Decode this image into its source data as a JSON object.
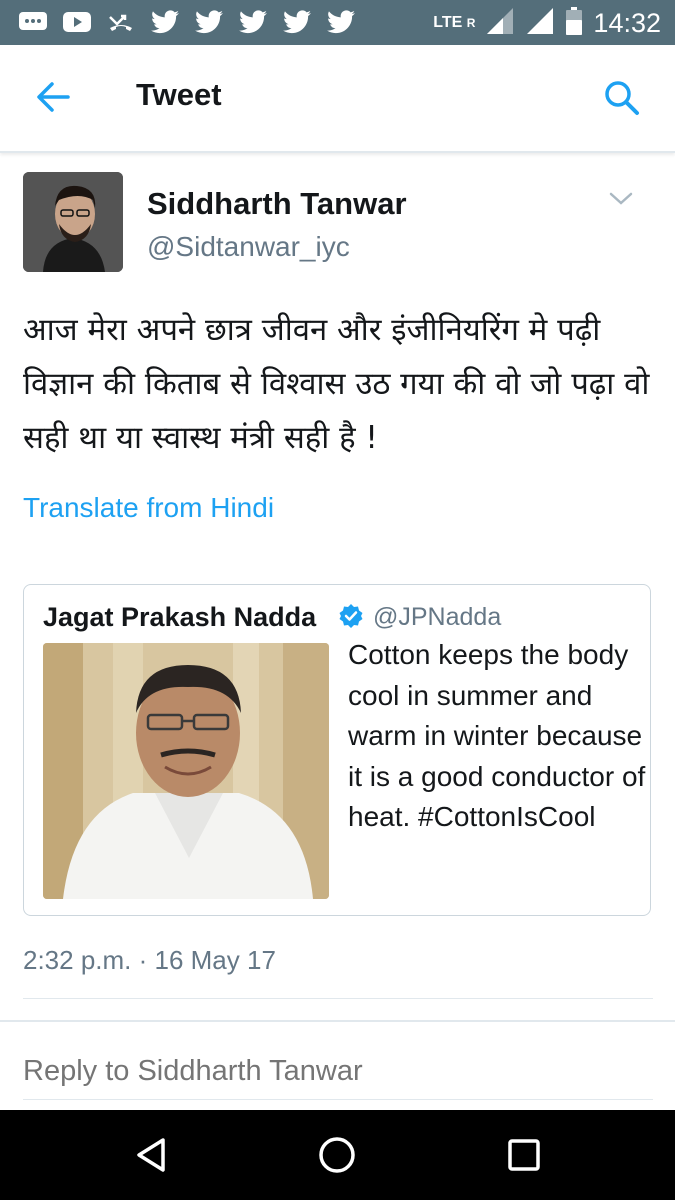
{
  "status_bar": {
    "time": "14:32",
    "network": "LTE",
    "network_sub": "R",
    "icons": [
      "messages-icon",
      "youtube-icon",
      "missed-call-icon",
      "twitter-icon",
      "twitter-icon",
      "twitter-icon",
      "twitter-icon",
      "twitter-icon",
      "signal-icon",
      "battery-icon"
    ]
  },
  "header": {
    "title": "Tweet",
    "back_icon": "arrow-left-icon",
    "search_icon": "search-icon",
    "accent_color": "#1da1f2"
  },
  "tweet": {
    "author_name": "Siddharth Tanwar",
    "author_handle": "@Sidtanwar_iyc",
    "text": "आज मेरा अपने छात्र जीवन और इंजीनियरिंग मे पढ़ी विज्ञान की किताब से विश्वास उठ गया की वो जो पढ़ा वो सही था या स्वास्थ मंत्री सही है !",
    "translate_label": "Translate from Hindi",
    "timestamp": "2:32 p.m. · 16 May 17"
  },
  "quoted_tweet": {
    "author_name": "Jagat Prakash Nadda",
    "author_handle": "@JPNadda",
    "verified": true,
    "text": "Cotton keeps the body cool in summer and warm in winter because it is a good conductor of heat. #CottonIsCool"
  },
  "reply": {
    "placeholder": "Reply to Siddharth Tanwar"
  },
  "nav_bar": {
    "icons": [
      "nav-back-icon",
      "nav-home-icon",
      "nav-recents-icon"
    ]
  }
}
